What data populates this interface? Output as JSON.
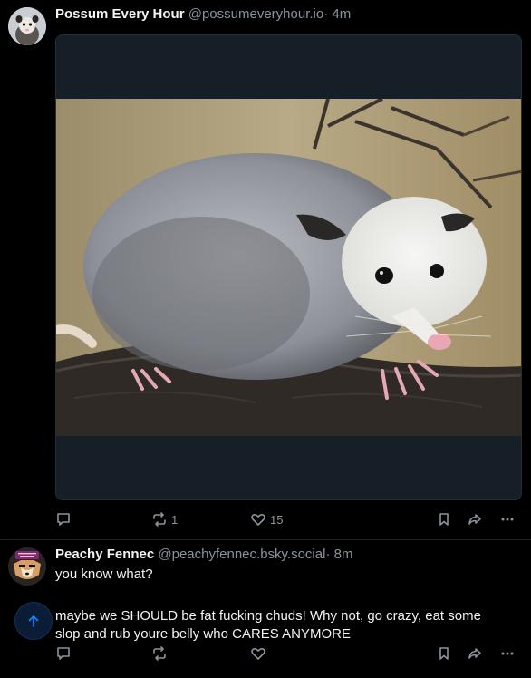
{
  "posts": [
    {
      "author": {
        "display_name": "Possum Every Hour",
        "handle": "@possumeveryhour.io",
        "separator": "·",
        "time": "4m",
        "avatar_icon": "possum-avatar"
      },
      "media_icon": "opossum-photo",
      "actions": {
        "reply_count": "",
        "repost_count": "1",
        "like_count": "15"
      }
    },
    {
      "author": {
        "display_name": "Peachy Fennec",
        "handle": "@peachyfennec.bsky.social",
        "separator": "·",
        "time": "8m",
        "avatar_icon": "fennec-avatar"
      },
      "text": [
        "you know what?",
        "maybe we SHOULD be fat fucking chuds! Why not, go crazy, eat some slop and rub youre belly who CARES ANYMORE"
      ],
      "actions": {
        "reply_count": "",
        "repost_count": "",
        "like_count": ""
      }
    }
  ],
  "colors": {
    "background": "#000000",
    "text": "#f1f3f5",
    "muted": "#8a939d",
    "accent": "#1083fe"
  }
}
